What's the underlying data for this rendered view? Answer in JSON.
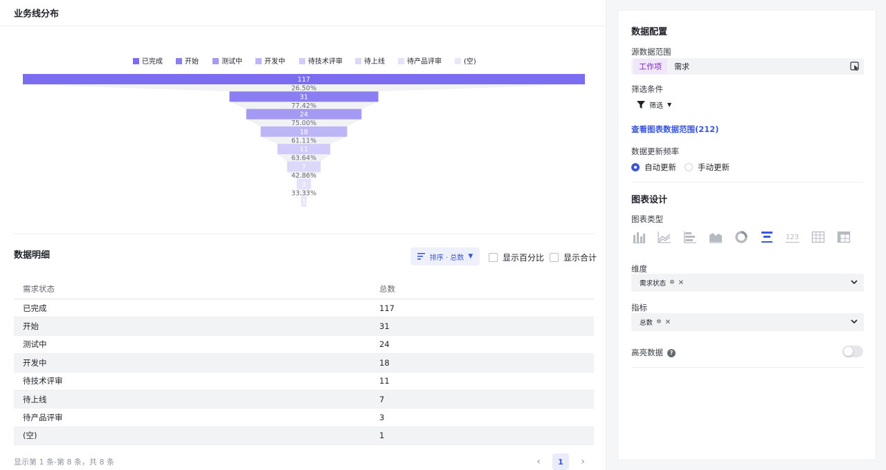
{
  "left_header": {
    "title": "业务线分布"
  },
  "chart_data": {
    "type": "funnel",
    "legend_position": "top",
    "categories": [
      "已完成",
      "开始",
      "测试中",
      "开发中",
      "待技术评审",
      "待上线",
      "待产品评审",
      "(空)"
    ],
    "values": [
      117,
      31,
      24,
      18,
      11,
      7,
      3,
      1
    ],
    "conversion_labels": [
      "26.50%",
      "77.42%",
      "75.00%",
      "61.11%",
      "63.64%",
      "42.86%",
      "33.33%"
    ],
    "colors": [
      "#7b6cf0",
      "#8b7ef2",
      "#a49af4",
      "#bdb6f6",
      "#d0cbf8",
      "#dcd8fa",
      "#e4e1fb",
      "#e8e6fb"
    ]
  },
  "detail": {
    "title": "数据明细",
    "sort_label": "排序 · 总数",
    "show_percent_label": "显示百分比",
    "show_total_label": "显示合计",
    "columns": [
      "需求状态",
      "总数"
    ],
    "rows": [
      [
        "已完成",
        "117"
      ],
      [
        "开始",
        "31"
      ],
      [
        "测试中",
        "24"
      ],
      [
        "开发中",
        "18"
      ],
      [
        "待技术评审",
        "11"
      ],
      [
        "待上线",
        "7"
      ],
      [
        "待产品评审",
        "3"
      ],
      [
        "(空)",
        "1"
      ]
    ],
    "footer": "显示第 1 条-第 8 条，共 8 条",
    "page": "1"
  },
  "config": {
    "data_config_title": "数据配置",
    "source_label": "源数据范围",
    "source_tag": "工作项",
    "source_value": "需求",
    "filter_label": "筛选条件",
    "filter_button": "筛选",
    "view_link": "查看图表数据范围(212)",
    "refresh_label": "数据更新频率",
    "refresh_auto": "自动更新",
    "refresh_manual": "手动更新",
    "design_title": "图表设计",
    "chart_type_label": "图表类型",
    "dimension_label": "维度",
    "dimension_chip": "需求状态",
    "metric_label": "指标",
    "metric_chip": "总数",
    "highlight_label": "高亮数据",
    "accent_color": "#3b57d9"
  }
}
